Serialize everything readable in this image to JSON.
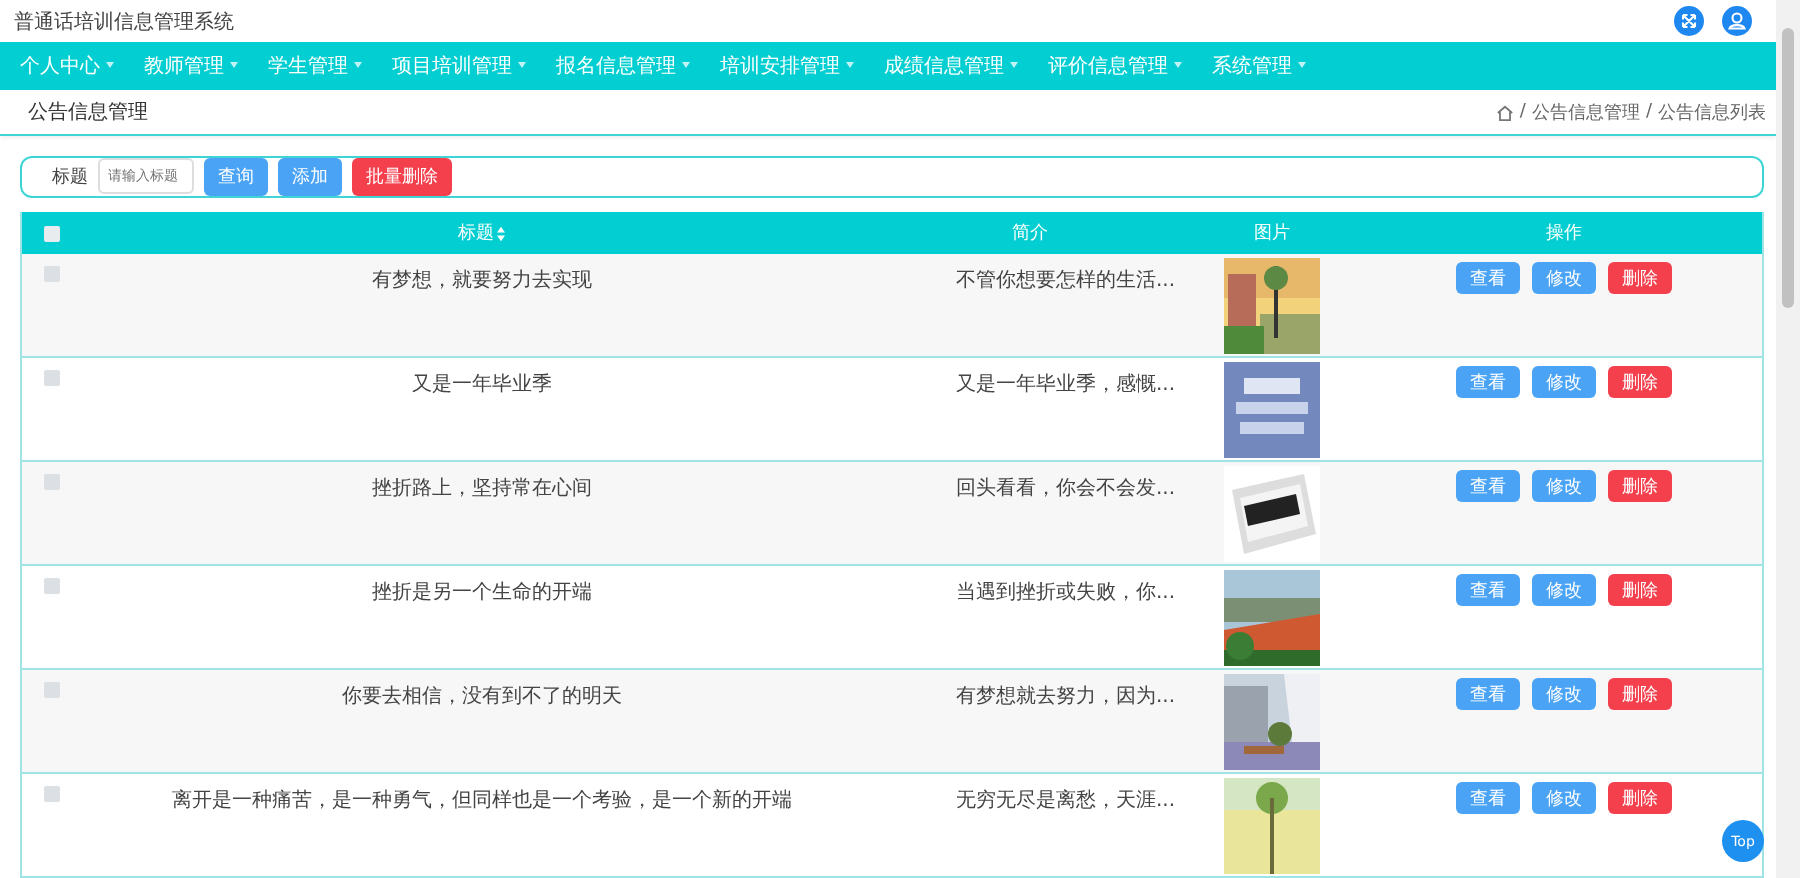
{
  "app_title": "普通话培训信息管理系统",
  "nav": [
    {
      "label": "个人中心"
    },
    {
      "label": "教师管理"
    },
    {
      "label": "学生管理"
    },
    {
      "label": "项目培训管理"
    },
    {
      "label": "报名信息管理"
    },
    {
      "label": "培训安排管理"
    },
    {
      "label": "成绩信息管理"
    },
    {
      "label": "评价信息管理"
    },
    {
      "label": "系统管理"
    }
  ],
  "page_title": "公告信息管理",
  "breadcrumb": [
    {
      "separator": "/",
      "label": "公告信息管理"
    },
    {
      "separator": "/",
      "label": "公告信息列表"
    }
  ],
  "search": {
    "label": "标题",
    "placeholder": "请输入标题",
    "buttons": [
      {
        "label": "查询",
        "kind": "primary"
      },
      {
        "label": "添加",
        "kind": "primary"
      },
      {
        "label": "批量删除",
        "kind": "danger"
      }
    ]
  },
  "table": {
    "select_all": {
      "checked": false
    },
    "columns": [
      {
        "label": "标题",
        "sortable": true
      },
      {
        "label": "简介",
        "sortable": false
      },
      {
        "label": "图片",
        "sortable": false
      },
      {
        "label": "操作",
        "sortable": false
      }
    ],
    "rows": [
      {
        "checked": false,
        "title": "有梦想，就要努力去实现",
        "intro": "不管你想要怎样的生活...",
        "picture": {
          "kind": "picture"
        },
        "actions": [
          {
            "label": "查看",
            "kind": "primary"
          },
          {
            "label": "修改",
            "kind": "primary"
          },
          {
            "label": "删除",
            "kind": "danger"
          }
        ]
      },
      {
        "checked": false,
        "title": "又是一年毕业季",
        "intro": "又是一年毕业季，感慨...",
        "picture": {
          "kind": "picture"
        },
        "actions": [
          {
            "label": "查看",
            "kind": "primary"
          },
          {
            "label": "修改",
            "kind": "primary"
          },
          {
            "label": "删除",
            "kind": "danger"
          }
        ]
      },
      {
        "checked": false,
        "title": "挫折路上，坚持常在心间",
        "intro": "回头看看，你会不会发...",
        "picture": {
          "kind": "picture"
        },
        "actions": [
          {
            "label": "查看",
            "kind": "primary"
          },
          {
            "label": "修改",
            "kind": "primary"
          },
          {
            "label": "删除",
            "kind": "danger"
          }
        ]
      },
      {
        "checked": false,
        "title": "挫折是另一个生命的开端",
        "intro": "当遇到挫折或失败，你...",
        "picture": {
          "kind": "picture"
        },
        "actions": [
          {
            "label": "查看",
            "kind": "primary"
          },
          {
            "label": "修改",
            "kind": "primary"
          },
          {
            "label": "删除",
            "kind": "danger"
          }
        ]
      },
      {
        "checked": false,
        "title": "你要去相信，没有到不了的明天",
        "intro": "有梦想就去努力，因为...",
        "picture": {
          "kind": "picture"
        },
        "actions": [
          {
            "label": "查看",
            "kind": "primary"
          },
          {
            "label": "修改",
            "kind": "primary"
          },
          {
            "label": "删除",
            "kind": "danger"
          }
        ]
      },
      {
        "checked": false,
        "title": "离开是一种痛苦，是一种勇气，但同样也是一个考验，是一个新的开端",
        "intro": "无穷无尽是离愁，天涯...",
        "picture": {
          "kind": "picture"
        },
        "actions": [
          {
            "label": "查看",
            "kind": "primary"
          },
          {
            "label": "修改",
            "kind": "primary"
          },
          {
            "label": "删除",
            "kind": "danger"
          }
        ]
      }
    ]
  },
  "back_to_top": "Top"
}
